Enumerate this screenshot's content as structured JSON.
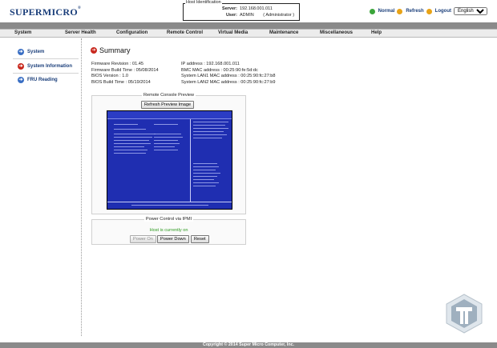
{
  "brand": {
    "logo_text": "SUPERMICRO"
  },
  "host": {
    "title": "Host Identification",
    "server_label": "Server:",
    "server_value": "192.168.001.011",
    "user_label": "User:",
    "user_value": "ADMIN",
    "user_role": "( Administrator )"
  },
  "toplinks": {
    "normal": "Normal",
    "refresh": "Refresh",
    "logout": "Logout",
    "language": "English"
  },
  "menu": [
    "System",
    "Server Health",
    "Configuration",
    "Remote Control",
    "Virtual Media",
    "Maintenance",
    "Miscellaneous",
    "Help"
  ],
  "sidebar": {
    "items": [
      {
        "label": "System",
        "color": "#3a6fc4"
      },
      {
        "label": "System Information",
        "color": "#c8281e"
      },
      {
        "label": "FRU Reading",
        "color": "#3a6fc4"
      }
    ]
  },
  "summary": {
    "title": "Summary",
    "left": [
      "Firmware Revision : 01.45",
      "Firmware Build Time : 05/08/2014",
      "BIOS Version : 1.0",
      "BIOS Build Time : 05/19/2014"
    ],
    "right": [
      "IP address : 192.168.001.011",
      "BMC MAC address : 00:25:90:fe:5d:dc",
      "System LAN1 MAC address : 00:25:90:fc:27:b8",
      "System LAN2 MAC address : 00:25:90:fc:27:b9"
    ]
  },
  "preview": {
    "title": "Remote Console Preview",
    "refresh_button": "Refresh Preview Image"
  },
  "power": {
    "title": "Power Control via IPMI",
    "status": "Host is currently on",
    "buttons": {
      "power_on": "Power On",
      "power_down": "Power Down",
      "reset": "Reset"
    }
  },
  "footer": {
    "text": "Copyright © 2014 Super Micro Computer, Inc."
  },
  "colors": {
    "accent_blue": "#1a3e7a",
    "status_green": "#2c9a1e",
    "bios_blue": "#1f2eb1"
  }
}
